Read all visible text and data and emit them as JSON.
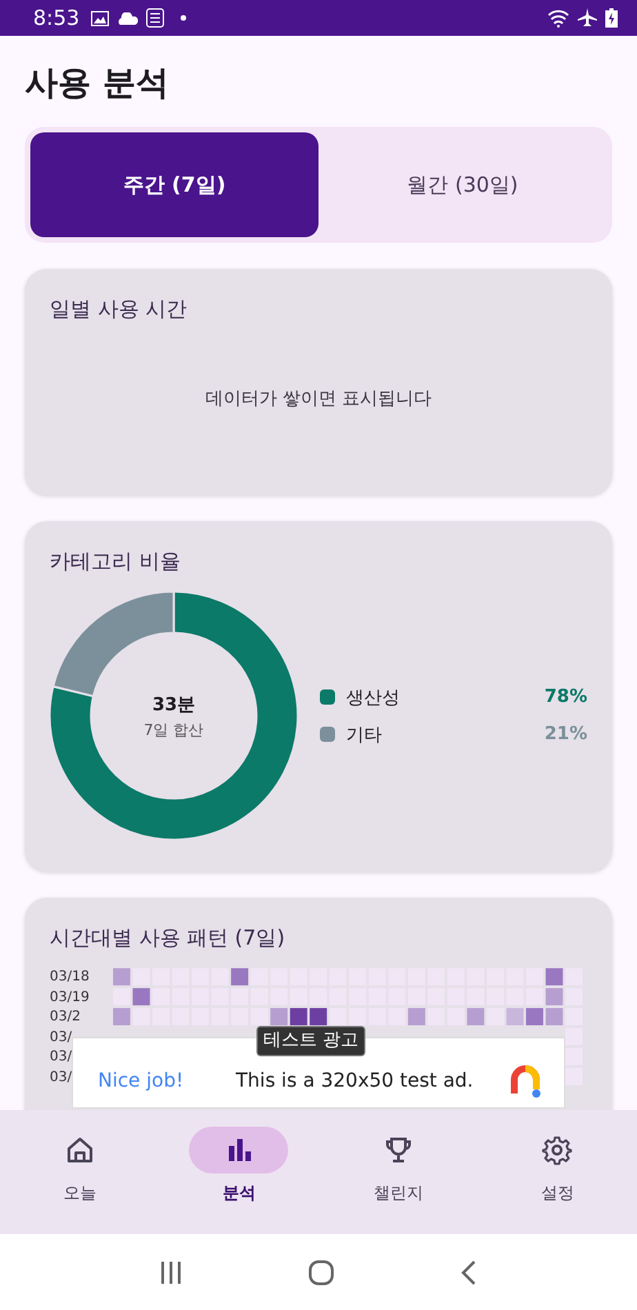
{
  "status_bar": {
    "time": "8:53"
  },
  "title": "사용 분석",
  "period_tabs": [
    {
      "label": "주간 (7일)",
      "selected": true
    },
    {
      "label": "월간 (30일)",
      "selected": false
    }
  ],
  "daily_usage": {
    "title": "일별 사용 시간",
    "empty_message": "데이터가 쌓이면 표시됩니다"
  },
  "category_ratio": {
    "title": "카테고리 비율",
    "total": "33분",
    "total_caption": "7일 합산",
    "chart_data": {
      "type": "donut",
      "categories": [
        "생산성",
        "기타"
      ],
      "values": [
        78,
        21
      ]
    },
    "legend": [
      {
        "percent": "78%",
        "color": "#0b7a68"
      },
      {
        "percent": "21%",
        "color": "#7b909a"
      }
    ]
  },
  "hourly_pattern": {
    "title": "시간대별 사용 패턴 (7일)",
    "row_labels": [
      "03/18",
      "03/19",
      "03/2",
      "03/",
      "03/",
      "03/"
    ]
  },
  "ad": {
    "tag": "테스트 광고",
    "headline": "Nice job!",
    "text": "This is a 320x50 test ad."
  },
  "bottom_nav": [
    {
      "label": "오늘",
      "selected": false
    },
    {
      "label": "분석",
      "selected": true
    },
    {
      "label": "챌린지",
      "selected": false
    },
    {
      "label": "설정",
      "selected": false
    }
  ]
}
